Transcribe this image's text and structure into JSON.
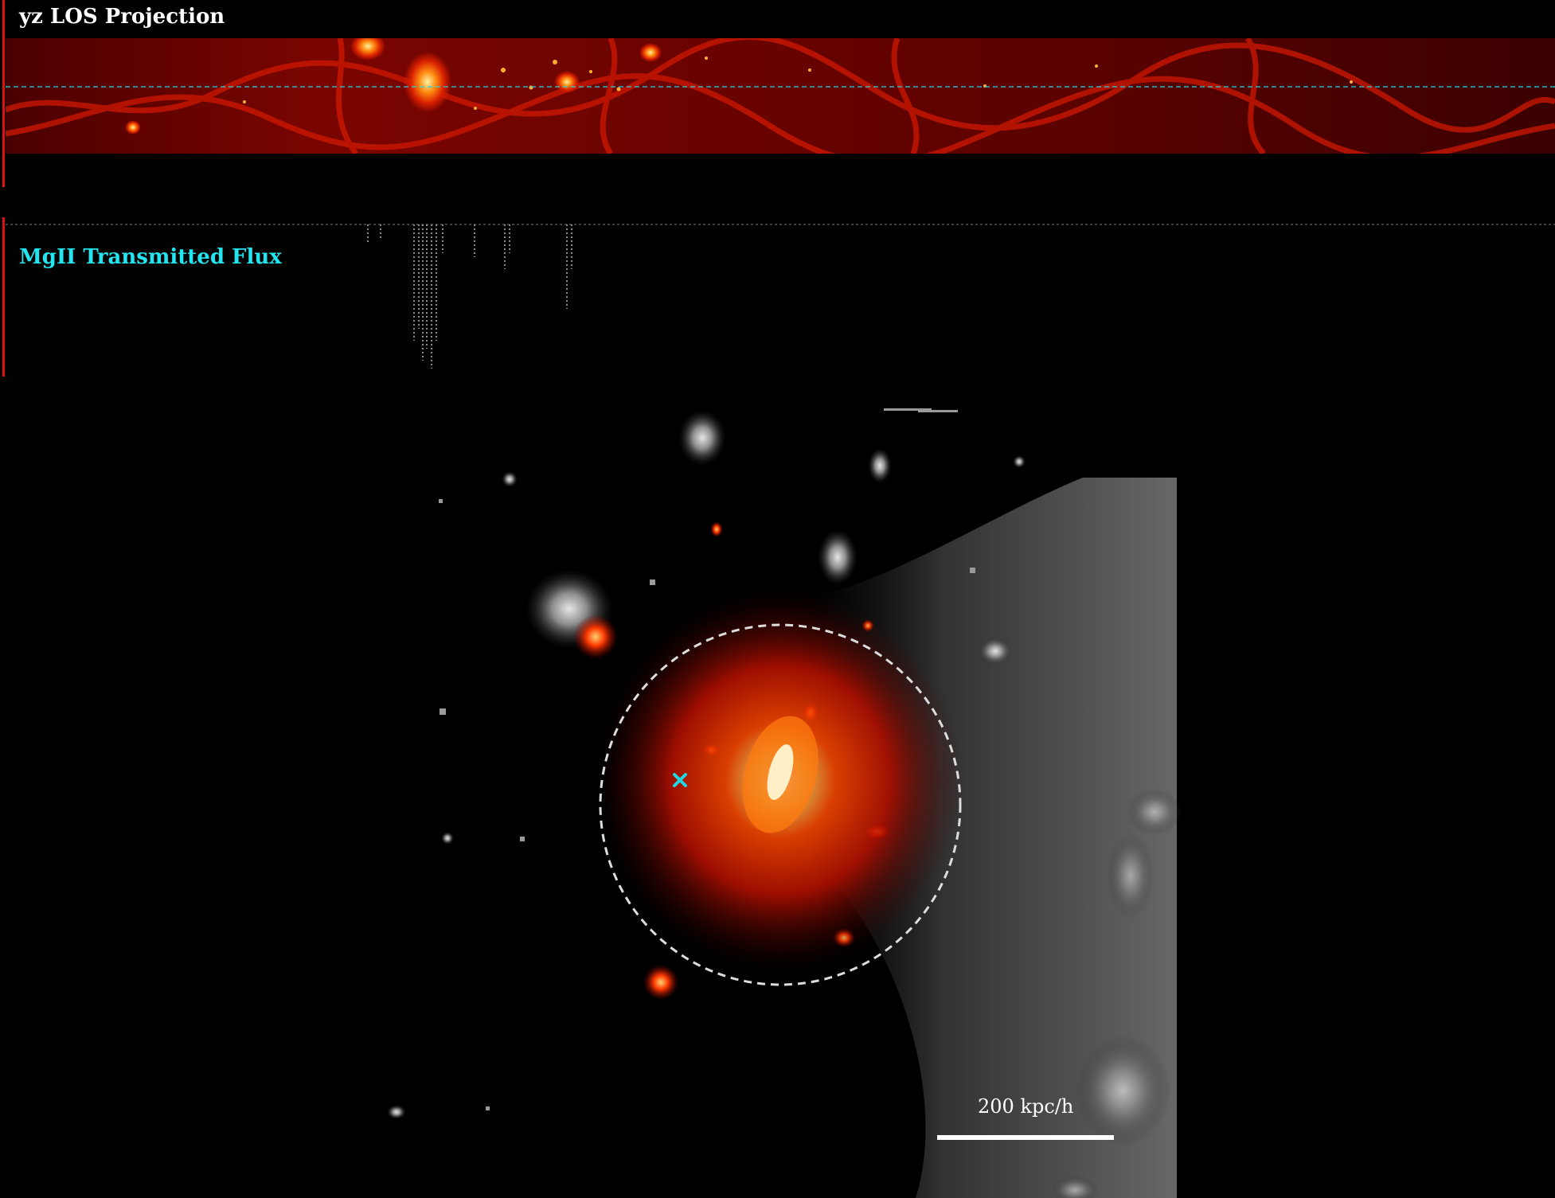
{
  "projection_panel": {
    "title": "yz LOS Projection"
  },
  "flux_panel": {
    "title": "MgII Transmitted Flux"
  },
  "main_view": {
    "scale_label": "200 kpc/h"
  },
  "colors": {
    "sightline": "#1fd6e6",
    "halo_circle": "#dddddd",
    "heat": "#ff3b00",
    "background": "#000000"
  }
}
